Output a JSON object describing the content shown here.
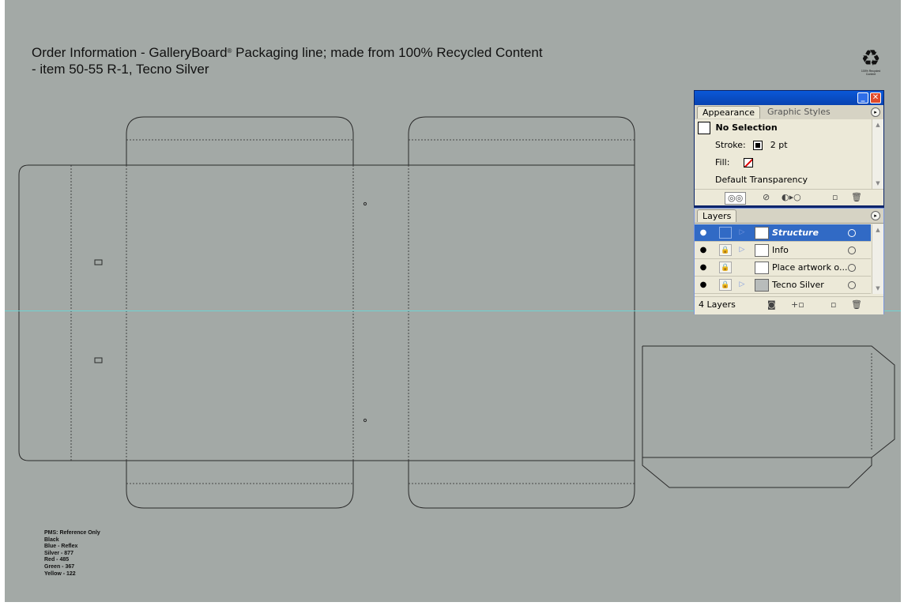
{
  "artboard": {
    "title_line1_pre": "Order Information - GalleryBoard",
    "title_reg_mark": "®",
    "title_line1_post": " Packaging line; made from 100% Recycled Content",
    "title_line2": "- item 50-55 R-1, Tecno Silver",
    "recycle_logo_text": "100% Recycled Content",
    "pms_notes": [
      "PMS: Reference Only",
      "Black",
      "Blue - Reflex",
      "Silver - 877",
      "Red - 485",
      "Green - 367",
      "Yellow - 122"
    ],
    "background_color": "#a3a9a6",
    "guide_color": "#6fd3d3"
  },
  "window": {
    "minimize_glyph": "_",
    "close_glyph": "✕"
  },
  "appearance_panel": {
    "tabs": [
      "Appearance",
      "Graphic Styles"
    ],
    "active_tab": "Appearance",
    "selection_label": "No Selection",
    "stroke_label": "Stroke:",
    "stroke_value": "2 pt",
    "stroke_color": "#000000",
    "fill_label": "Fill:",
    "fill_color": "none",
    "transparency_label": "Default Transparency",
    "bottom_icons": [
      "new-art-basic-icon",
      "clear-appearance-icon",
      "reduce-to-basic-icon",
      "duplicate-item-icon",
      "delete-item-icon"
    ]
  },
  "layers_panel": {
    "tab": "Layers",
    "layers": [
      {
        "name": "Structure",
        "selected": true,
        "locked": false,
        "expandable": true
      },
      {
        "name": "Info",
        "selected": false,
        "locked": true,
        "expandable": true
      },
      {
        "name": "Place artwork o...",
        "selected": false,
        "locked": true,
        "expandable": false
      },
      {
        "name": "Tecno Silver",
        "selected": false,
        "locked": true,
        "expandable": true
      }
    ],
    "count_label": "4 Layers",
    "bottom_icons": [
      "make-clipping-mask-icon",
      "new-sublayer-icon",
      "new-layer-icon",
      "delete-layer-icon"
    ]
  }
}
